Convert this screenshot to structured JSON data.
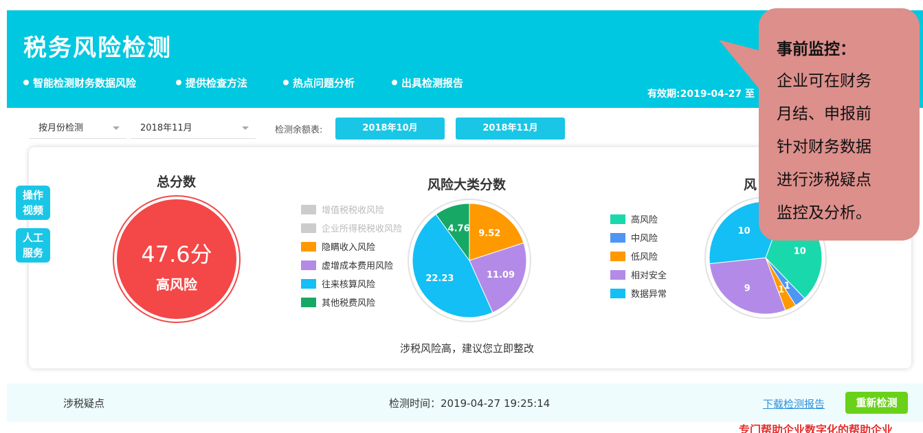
{
  "header": {
    "title": "税务风险检测",
    "features": [
      "智能检测财务数据风险",
      "提供检查方法",
      "热点问题分析",
      "出具检测报告"
    ],
    "validity": "有效期:2019-04-27 至"
  },
  "controls": {
    "mode_select": "按月份检测",
    "month_select": "2018年11月",
    "balance_label": "检测余额表:",
    "month_buttons": [
      "2018年10月",
      "2018年11月"
    ]
  },
  "side_buttons": {
    "tutorial": "操作\n视频",
    "service": "人工\n服务"
  },
  "total_score": {
    "title": "总分数",
    "value": "47.6分",
    "level": "高风险"
  },
  "category_chart": {
    "title": "风险大类分数",
    "note": "涉税风险高，建议您立即整改",
    "legend": [
      {
        "label": "增值税税收风险",
        "color": "#cccccc",
        "faded": true
      },
      {
        "label": "企业所得税税收风险",
        "color": "#cccccc",
        "faded": true
      },
      {
        "label": "隐瞒收入风险",
        "color": "#ff9900",
        "faded": false
      },
      {
        "label": "虚增成本费用风险",
        "color": "#b38ae8",
        "faded": false
      },
      {
        "label": "往来核算风险",
        "color": "#13bff5",
        "faded": false
      },
      {
        "label": "其他税费风险",
        "color": "#17a866",
        "faded": false
      }
    ]
  },
  "level_chart": {
    "title_partial": "风",
    "legend": [
      {
        "label": "高风险",
        "color": "#19d9ac"
      },
      {
        "label": "中风险",
        "color": "#4d96f5"
      },
      {
        "label": "低风险",
        "color": "#ff9900"
      },
      {
        "label": "相对安全",
        "color": "#b38ae8"
      },
      {
        "label": "数据异常",
        "color": "#13bff5"
      }
    ]
  },
  "chart_data": [
    {
      "type": "pie",
      "title": "风险大类分数",
      "slices": [
        {
          "label": "隐瞒收入风险",
          "value": 9.52,
          "color": "#ff9900"
        },
        {
          "label": "虚增成本费用风险",
          "value": 11.09,
          "color": "#b38ae8"
        },
        {
          "label": "往来核算风险",
          "value": 22.23,
          "color": "#13bff5"
        },
        {
          "label": "其他税费风险",
          "value": 4.76,
          "color": "#17a866"
        }
      ]
    },
    {
      "type": "pie",
      "title": "",
      "slices": [
        {
          "label": "高风险",
          "value": 10,
          "color": "#19d9ac"
        },
        {
          "label": "中风险",
          "value": 1,
          "color": "#4d96f5"
        },
        {
          "label": "低风险",
          "value": 1,
          "color": "#ff9900"
        },
        {
          "label": "相对安全",
          "value": 9,
          "color": "#b38ae8"
        },
        {
          "label": "数据异常",
          "value": 10,
          "color": "#13bff5"
        }
      ]
    }
  ],
  "bottom": {
    "doubt_label": "涉税疑点",
    "detect_time": "检测时间：2019-04-27 19:25:14",
    "download": "下载检测报告",
    "recheck": "重新检测"
  },
  "callout": {
    "title": "事前监控：",
    "lines": [
      "企业可在财务",
      "月结、申报前",
      "针对财务数据",
      "进行涉税疑点",
      "监控及分析。"
    ]
  },
  "footer_cut_text": "专门帮助企业数字化的帮助企业"
}
